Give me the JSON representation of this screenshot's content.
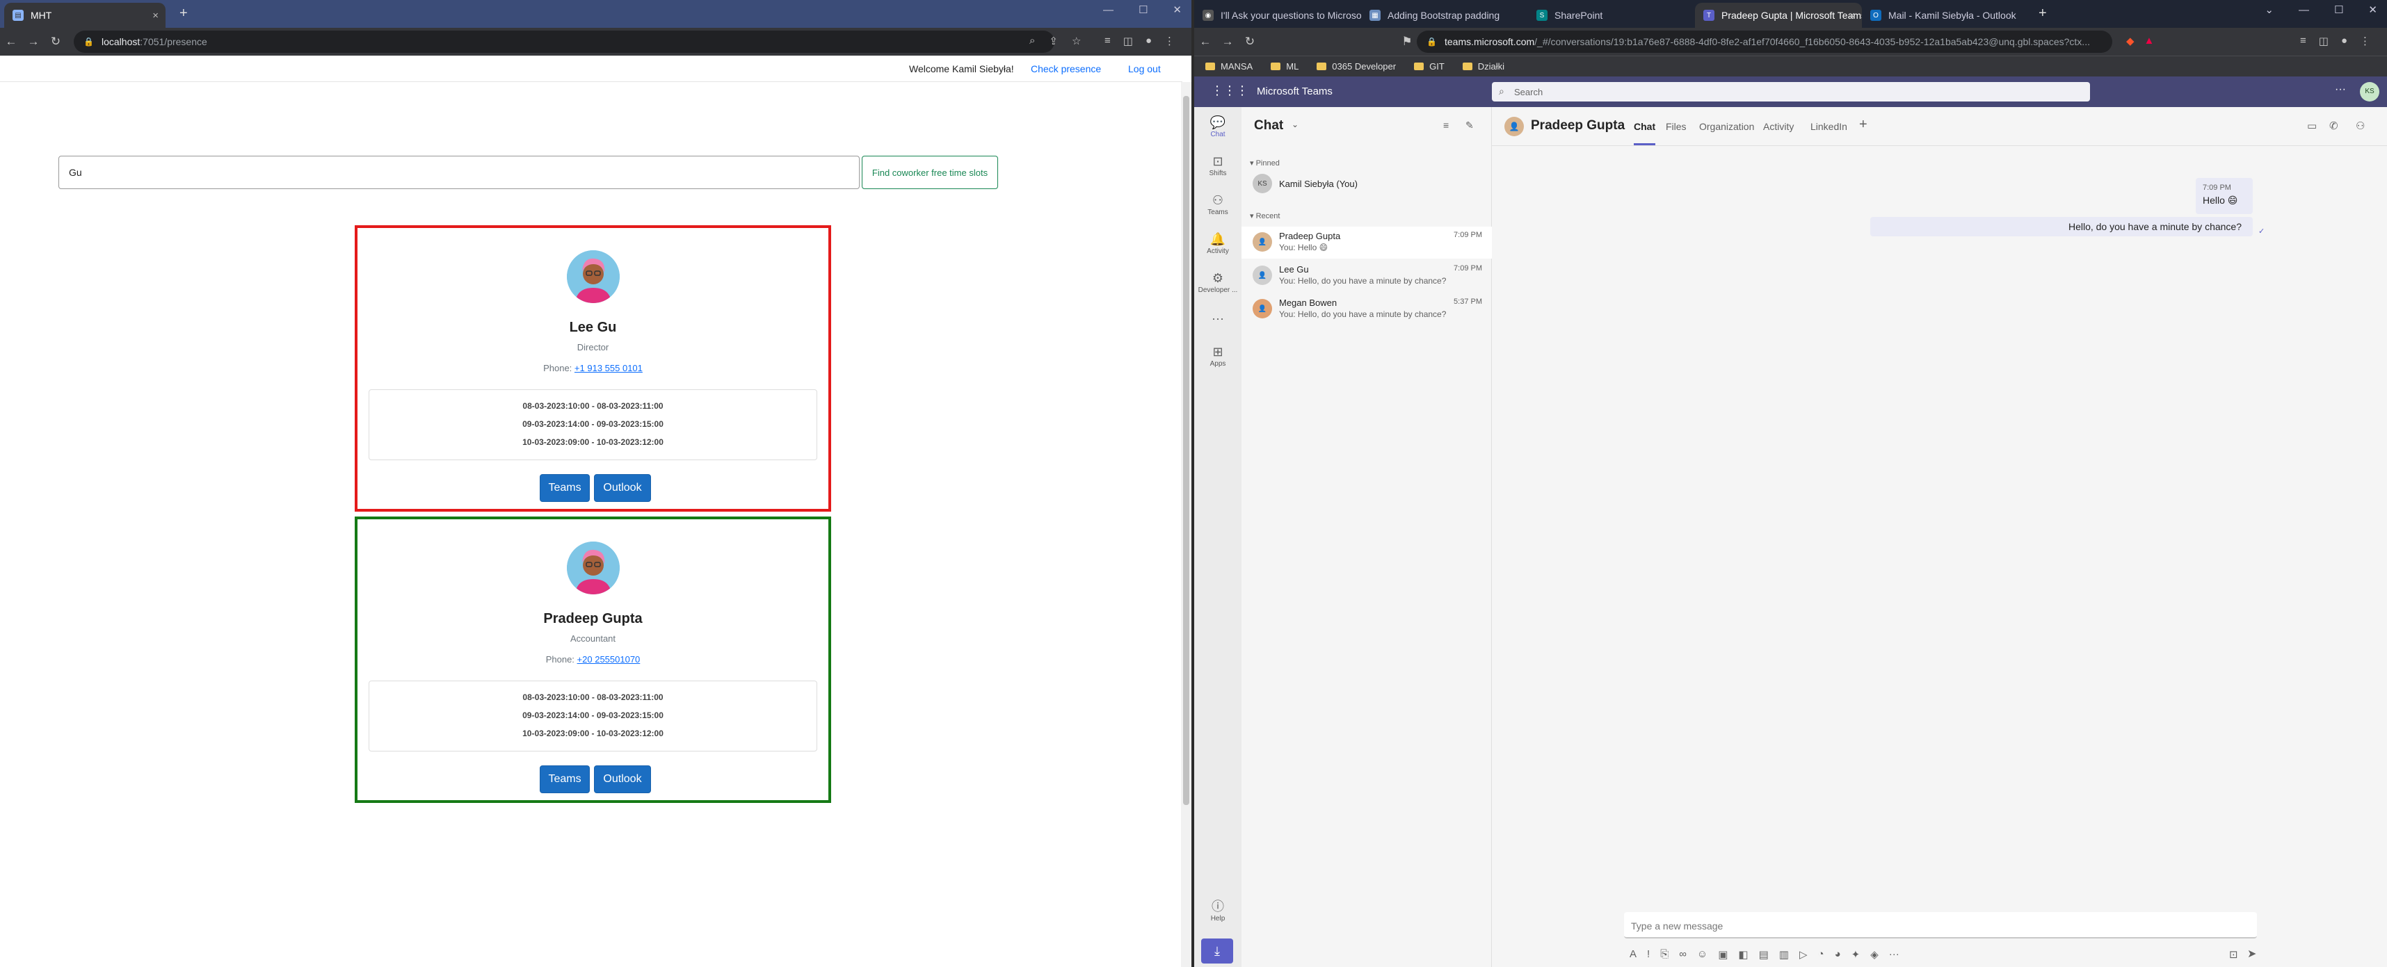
{
  "left_browser": {
    "tab_title": "MHT",
    "url": "localhost:7051/presence",
    "url_host": "localhost",
    "url_rest": ":7051/presence"
  },
  "app": {
    "welcome": "Welcome Kamil Siebyła!",
    "check_presence": "Check presence",
    "logout": "Log out",
    "search_value": "Gu",
    "find_button": "Find coworker free time slots",
    "cards": [
      {
        "name": "Lee Gu",
        "role": "Director",
        "phone_label": "Phone:",
        "phone": "+1 913 555 0101",
        "border_color": "#e41b1b",
        "slots": [
          "08-03-2023:10:00 - 08-03-2023:11:00",
          "09-03-2023:14:00 - 09-03-2023:15:00",
          "10-03-2023:09:00 - 10-03-2023:12:00"
        ],
        "teams": "Teams",
        "outlook": "Outlook"
      },
      {
        "name": "Pradeep Gupta",
        "role": "Accountant",
        "phone_label": "Phone:",
        "phone": "+20 255501070",
        "border_color": "#157a15",
        "slots": [
          "08-03-2023:10:00 - 08-03-2023:11:00",
          "09-03-2023:14:00 - 09-03-2023:15:00",
          "10-03-2023:09:00 - 10-03-2023:12:00"
        ],
        "teams": "Teams",
        "outlook": "Outlook"
      }
    ]
  },
  "right_browser": {
    "tabs": [
      "I'll Ask your questions to Microsoft e...",
      "Adding Bootstrap padding",
      "SharePoint",
      "Pradeep Gupta | Microsoft Teams",
      "Mail - Kamil Siebyła - Outlook"
    ],
    "url_host": "teams.microsoft.com",
    "url_rest": "/_#/conversations/19:b1a76e87-6888-4df0-8fe2-af1ef70f4660_f16b6050-8643-4035-b952-12a1ba5ab423@unq.gbl.spaces?ctx...",
    "bookmarks": [
      "MANSA",
      "ML",
      "0365 Developer",
      "GIT",
      "Działki"
    ]
  },
  "teams": {
    "app_name": "Microsoft Teams",
    "search_placeholder": "Search",
    "rail": [
      "Chat",
      "Shifts",
      "Teams",
      "Activity",
      "Developer ...",
      "Apps",
      "Help"
    ],
    "chat_title": "Chat",
    "pinned_label": "Pinned",
    "recent_label": "Recent",
    "pinned": [
      {
        "name": "Kamil Siebyła (You)",
        "initials": "KS"
      }
    ],
    "recent": [
      {
        "name": "Pradeep Gupta",
        "preview": "You: Hello 😄",
        "time": "7:09 PM"
      },
      {
        "name": "Lee Gu",
        "preview": "You: Hello, do you have a minute by chance?",
        "time": "7:09 PM"
      },
      {
        "name": "Megan Bowen",
        "preview": "You: Hello, do you have a minute by chance?",
        "time": "5:37 PM"
      }
    ],
    "conversation": {
      "name": "Pradeep Gupta",
      "tabs": [
        "Chat",
        "Files",
        "Organization",
        "Activity",
        "LinkedIn"
      ],
      "messages": [
        {
          "time": "7:09 PM",
          "text": "Hello 😄"
        },
        {
          "text": "Hello, do you have a minute by chance?"
        }
      ],
      "composer_placeholder": "Type a new message"
    }
  }
}
